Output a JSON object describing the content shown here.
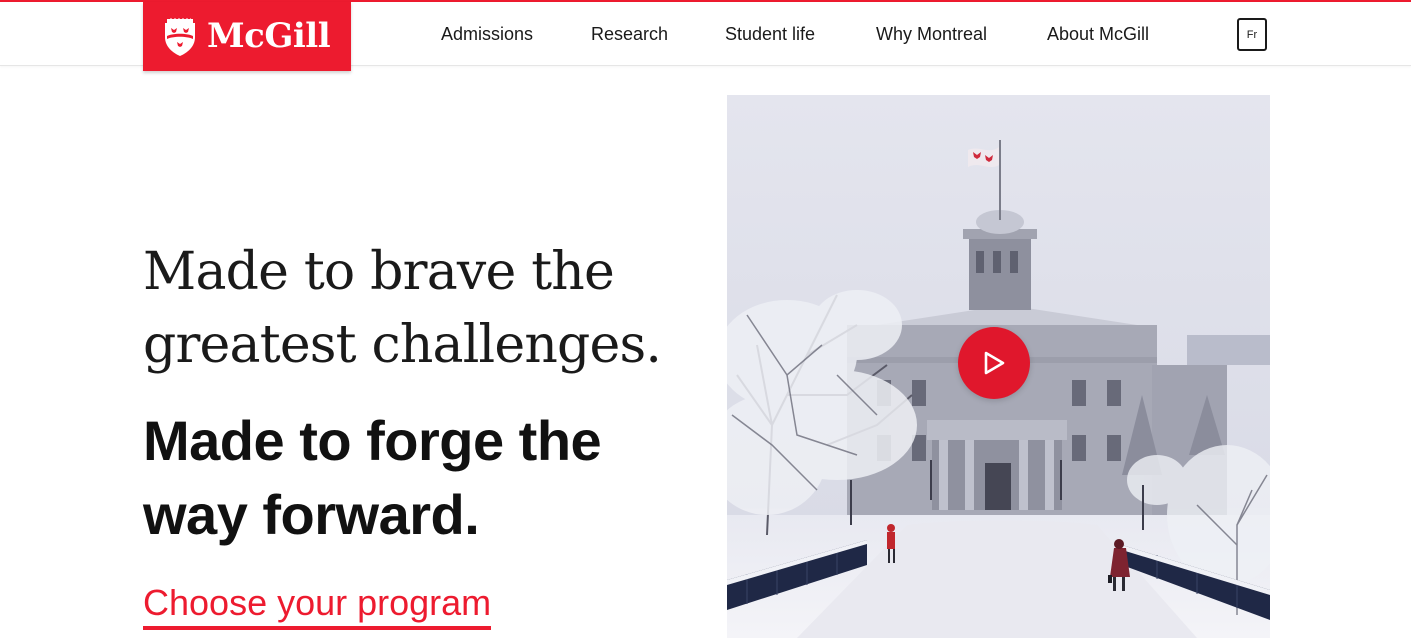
{
  "brand": {
    "name": "McGill",
    "accent_color": "#ed1b2f"
  },
  "nav": {
    "items": [
      {
        "label": "Admissions"
      },
      {
        "label": "Research"
      },
      {
        "label": "Student life"
      },
      {
        "label": "Why Montreal"
      },
      {
        "label": "About McGill"
      }
    ],
    "language_toggle": "Fr"
  },
  "hero": {
    "headline_serif": "Made to brave the greatest challenges.",
    "headline_bold": "Made to forge the way forward.",
    "cta_label": "Choose your program",
    "video_icon": "play-icon",
    "image_alt_icon": "campus-winter-image"
  }
}
